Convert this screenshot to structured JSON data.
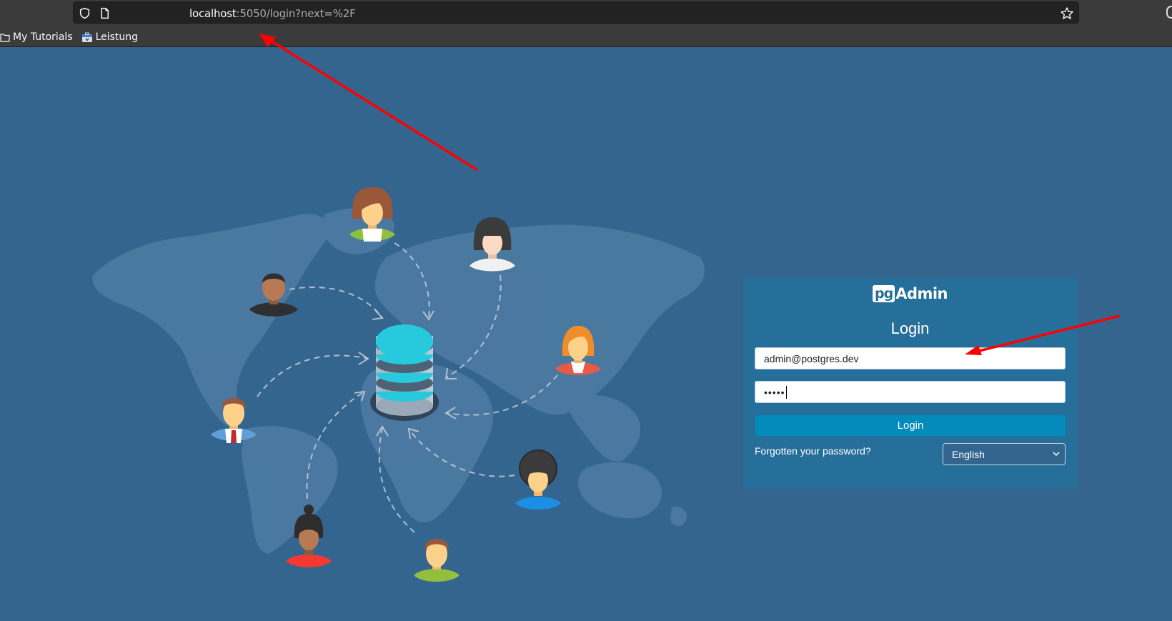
{
  "browser": {
    "url_host": "localhost",
    "url_rest": ":5050/login?next=%2F",
    "bookmarks": [
      {
        "label": "My Tutorials",
        "icon": "folder-icon"
      },
      {
        "label": "Leistung",
        "icon": "briefcase-icon"
      }
    ]
  },
  "login": {
    "logo_pg": "pg",
    "logo_admin": "Admin",
    "title": "Login",
    "email_value": "admin@postgres.dev",
    "password_masked": "•••••",
    "button_label": "Login",
    "forgot_link": "Forgotten your password?",
    "language_selected": "English"
  },
  "colors": {
    "page_background": "#33658f",
    "card_background": "#266f9a",
    "button": "#038bbb",
    "annotation_arrow": "#ff0000",
    "db_cyan": "#27c9dd"
  },
  "illustration": {
    "center": "database-icon",
    "avatars": [
      "woman-brown-hair",
      "woman-black-hair",
      "man-dark-skin",
      "woman-orange-hair",
      "man-suit-tie",
      "man-afro",
      "woman-bun",
      "man-green-shirt"
    ]
  }
}
